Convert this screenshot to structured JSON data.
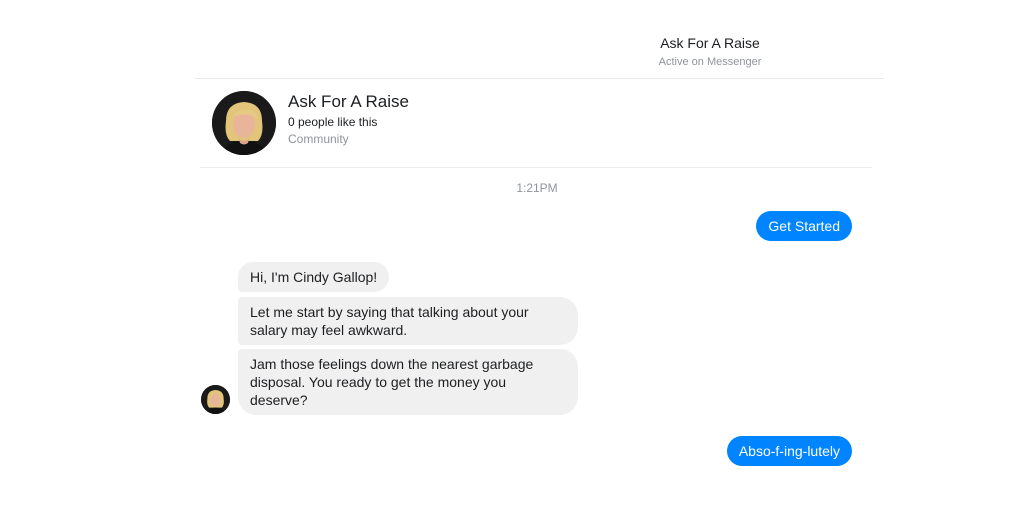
{
  "header": {
    "title": "Ask For A Raise",
    "status": "Active on Messenger"
  },
  "page_card": {
    "name": "Ask For A Raise",
    "likes": "0 people like this",
    "category": "Community"
  },
  "conversation": {
    "timestamp": "1:21PM",
    "messages": [
      {
        "from": "user",
        "text": "Get Started"
      },
      {
        "from": "bot",
        "text": "Hi, I'm Cindy Gallop!"
      },
      {
        "from": "bot",
        "text": "Let me start by saying that talking about your salary may feel awkward."
      },
      {
        "from": "bot",
        "text": "Jam those feelings down the nearest garbage disposal. You ready to get the money you deserve?"
      },
      {
        "from": "user",
        "text": "Abso-f-ing-lutely"
      }
    ]
  },
  "colors": {
    "outgoing_bubble": "#0084ff",
    "incoming_bubble": "#f1f0f0",
    "muted_text": "#90949c"
  }
}
